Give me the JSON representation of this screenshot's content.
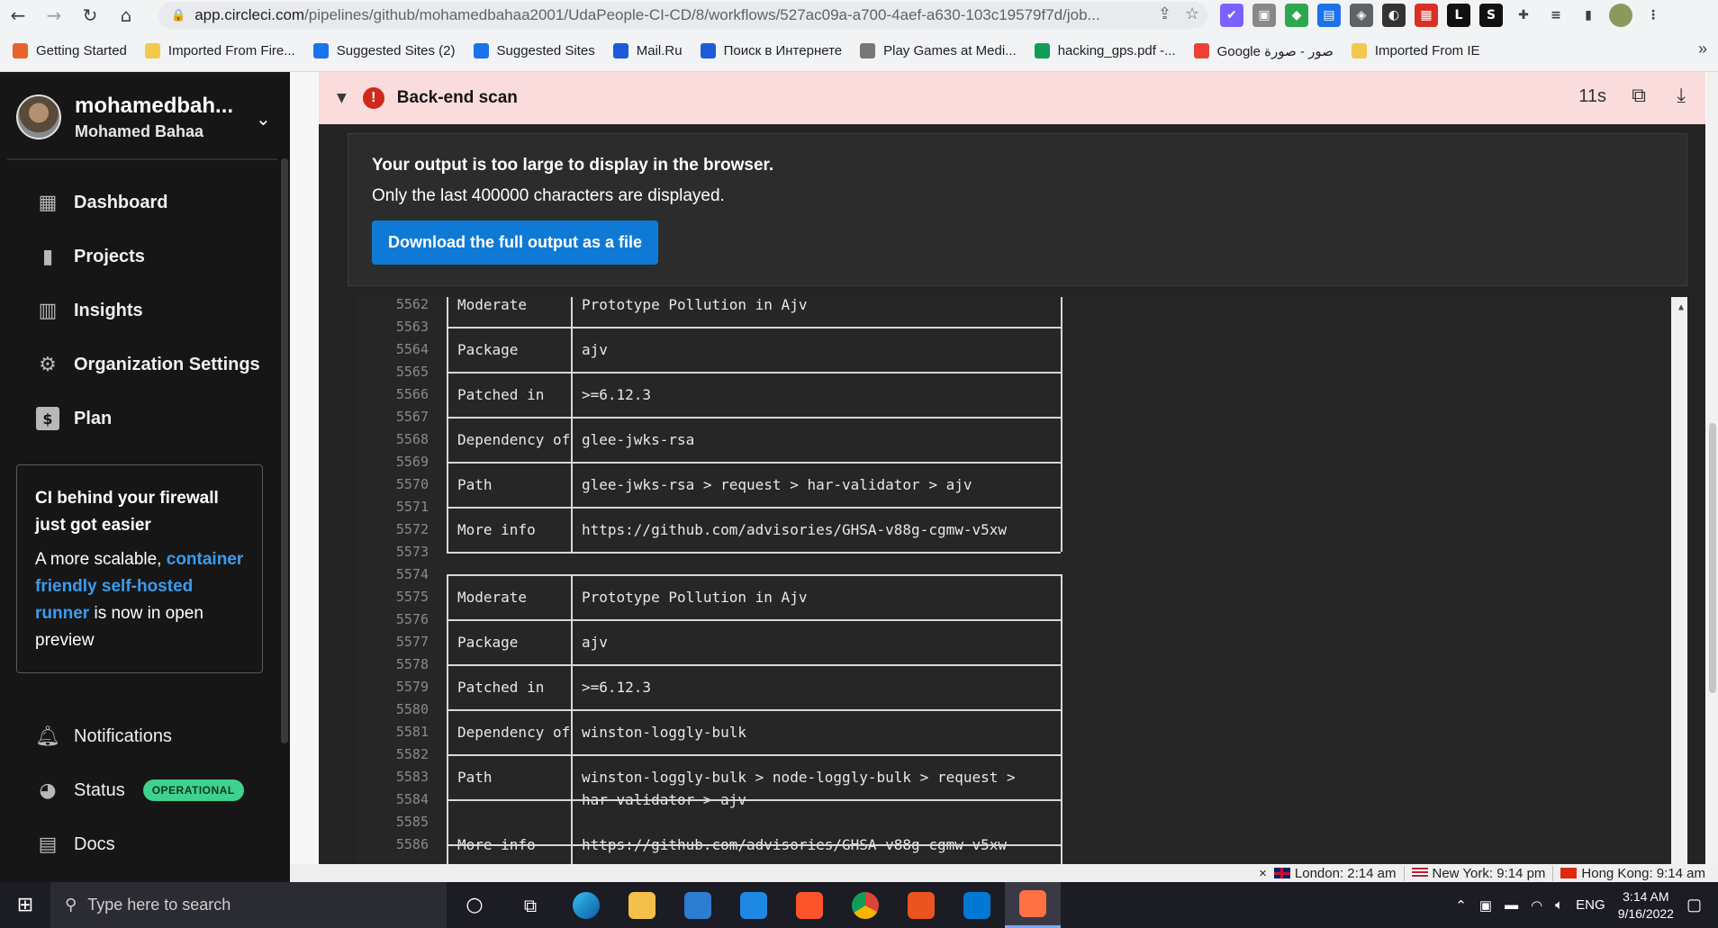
{
  "browser": {
    "url_host": "app.circleci.com",
    "url_path": "/pipelines/github/mohamedbahaa2001/UdaPeople-CI-CD/8/workflows/527ac09a-a700-4aef-a630-103c19579f7d/job...",
    "bookmarks": [
      {
        "label": "Getting Started",
        "color": "#e8632b"
      },
      {
        "label": "Imported From Fire...",
        "color": "#f2c94c"
      },
      {
        "label": "Suggested Sites (2)",
        "color": "#1a73e8"
      },
      {
        "label": "Suggested Sites",
        "color": "#1a73e8"
      },
      {
        "label": "Mail.Ru",
        "color": "#1e5bd8"
      },
      {
        "label": "Поиск в Интернете",
        "color": "#1e5bd8"
      },
      {
        "label": "Play Games at Medi...",
        "color": "#777777"
      },
      {
        "label": "hacking_gps.pdf -...",
        "color": "#0f9d58"
      },
      {
        "label": "Google صور - صورة",
        "color": "#ea4335"
      },
      {
        "label": "Imported From IE",
        "color": "#f2c94c"
      }
    ]
  },
  "sidebar": {
    "user_name": "mohamedbah...",
    "user_full": "Mohamed Bahaa",
    "nav": [
      {
        "label": "Dashboard",
        "icon": "dashboard-icon"
      },
      {
        "label": "Projects",
        "icon": "projects-icon"
      },
      {
        "label": "Insights",
        "icon": "insights-icon"
      },
      {
        "label": "Organization Settings",
        "icon": "gear-icon"
      },
      {
        "label": "Plan",
        "icon": "dollar-icon"
      }
    ],
    "promo": {
      "title": "CI behind your firewall just got easier",
      "prefix": "A more scalable, ",
      "link": "container friendly self-hosted runner",
      "suffix": " is now in open preview"
    },
    "bottom": [
      {
        "label": "Notifications",
        "icon": "bell-icon"
      },
      {
        "label": "Status",
        "icon": "status-icon"
      },
      {
        "label": "Docs",
        "icon": "docs-icon"
      }
    ],
    "status_badge": "OPERATIONAL"
  },
  "job": {
    "title": "Back-end scan",
    "duration": "11s",
    "notice_title": "Your output is too large to display in the browser.",
    "notice_sub": "Only the last 400000 characters are displayed.",
    "download_label": "Download the full output as a file"
  },
  "terminal": {
    "rows": [
      {
        "ln": "5562",
        "k": "Moderate",
        "v": "Prototype Pollution in Ajv"
      },
      {
        "ln": "5563"
      },
      {
        "ln": "5564",
        "k": "Package",
        "v": "ajv"
      },
      {
        "ln": "5565"
      },
      {
        "ln": "5566",
        "k": "Patched in",
        "v": ">=6.12.3"
      },
      {
        "ln": "5567"
      },
      {
        "ln": "5568",
        "k": "Dependency of",
        "v": "glee-jwks-rsa"
      },
      {
        "ln": "5569"
      },
      {
        "ln": "5570",
        "k": "Path",
        "v": "glee-jwks-rsa > request > har-validator > ajv"
      },
      {
        "ln": "5571"
      },
      {
        "ln": "5572",
        "k": "More info",
        "v": "https://github.com/advisories/GHSA-v88g-cgmw-v5xw"
      },
      {
        "ln": "5573"
      },
      {
        "ln": "5574"
      },
      {
        "ln": "5575",
        "k": "Moderate",
        "v": "Prototype Pollution in Ajv"
      },
      {
        "ln": "5576"
      },
      {
        "ln": "5577",
        "k": "Package",
        "v": "ajv"
      },
      {
        "ln": "5578"
      },
      {
        "ln": "5579",
        "k": "Patched in",
        "v": ">=6.12.3"
      },
      {
        "ln": "5580"
      },
      {
        "ln": "5581",
        "k": "Dependency of",
        "v": "winston-loggly-bulk"
      },
      {
        "ln": "5582"
      },
      {
        "ln": "5583",
        "k": "Path",
        "v": "winston-loggly-bulk > node-loggly-bulk > request >"
      },
      {
        "ln": "5584",
        "k": "",
        "v": "har-validator > ajv"
      },
      {
        "ln": "5585"
      },
      {
        "ln": "5586",
        "k": "More info",
        "v": "https://github.com/advisories/GHSA-v88g-cgmw-v5xw"
      }
    ]
  },
  "clocks": [
    {
      "label": "London: 2:14 am"
    },
    {
      "label": "New York: 9:14 pm"
    },
    {
      "label": "Hong Kong: 9:14 am"
    }
  ],
  "taskbar": {
    "search_placeholder": "Type here to search",
    "lang": "ENG",
    "time": "3:14 AM",
    "date": "9/16/2022"
  }
}
